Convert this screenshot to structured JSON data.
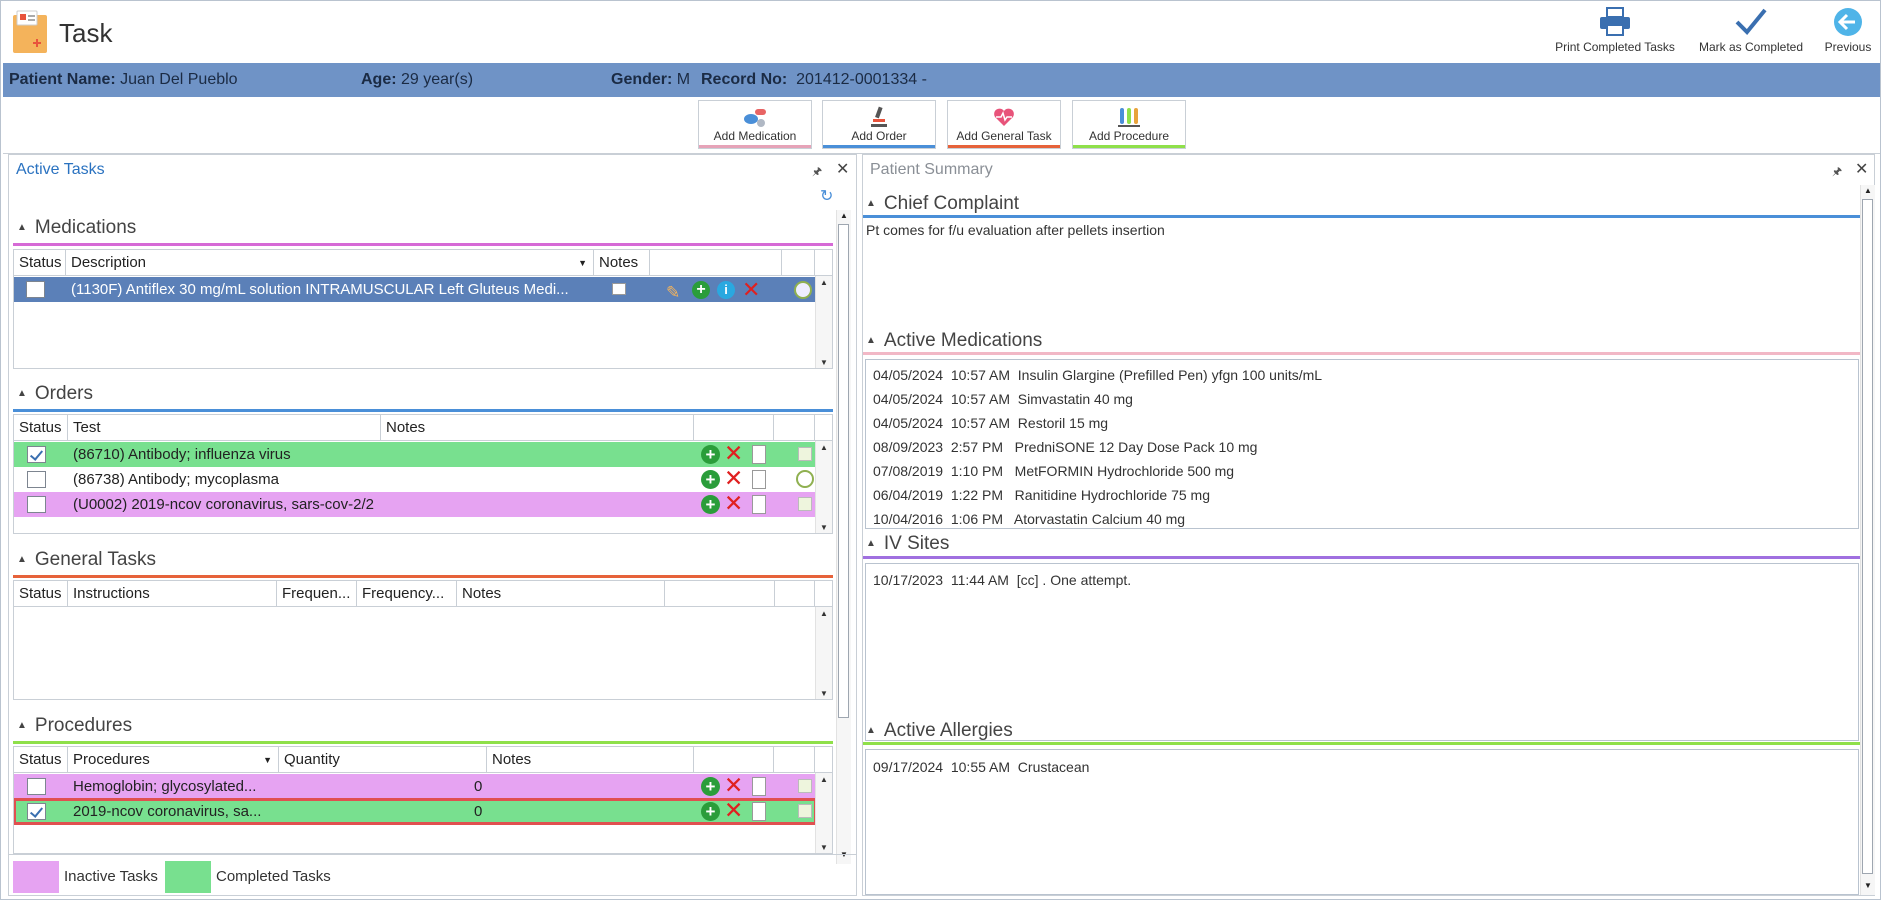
{
  "window": {
    "title": "Task"
  },
  "toolbar": {
    "print_label": "Print Completed Tasks",
    "complete_label": "Mark as Completed",
    "previous_label": "Previous"
  },
  "patient": {
    "name_label": "Patient Name:",
    "name": "Juan Del Pueblo",
    "age_label": "Age:",
    "age": "29 year(s)",
    "gender_label": "Gender:",
    "gender": "M",
    "record_label": "Record No:",
    "record": "201412-0001334 -"
  },
  "actions": {
    "add_medication": "Add Medication",
    "add_order": "Add Order",
    "add_general_task": "Add General Task",
    "add_procedure": "Add Procedure"
  },
  "active_tasks": {
    "title": "Active Tasks",
    "medications": {
      "heading": "Medications",
      "columns": [
        "Status",
        "Description",
        "Notes"
      ],
      "rows": [
        {
          "description": "(1130F) Antiflex 30 mg/mL solution INTRAMUSCULAR Left Gluteus Medi...",
          "checked": false
        }
      ]
    },
    "orders": {
      "heading": "Orders",
      "columns": [
        "Status",
        "Test",
        "Notes"
      ],
      "rows": [
        {
          "test": "(86710) Antibody; influenza virus",
          "checked": true,
          "state": "completed"
        },
        {
          "test": "(86738) Antibody; mycoplasma",
          "checked": false,
          "state": "active"
        },
        {
          "test": "(U0002) 2019-ncov coronavirus, sars-cov-2/2",
          "checked": false,
          "state": "inactive"
        }
      ]
    },
    "general_tasks": {
      "heading": "General Tasks",
      "columns": [
        "Status",
        "Instructions",
        "Frequen...",
        "Frequency...",
        "Notes"
      ]
    },
    "procedures": {
      "heading": "Procedures",
      "columns": [
        "Status",
        "Procedures",
        "Quantity",
        "Notes"
      ],
      "rows": [
        {
          "procedure": "Hemoglobin; glycosylated...",
          "quantity": "0",
          "checked": false,
          "state": "inactive"
        },
        {
          "procedure": "2019-ncov coronavirus, sa...",
          "quantity": "0",
          "checked": true,
          "state": "completed"
        }
      ]
    },
    "legend": {
      "inactive": "Inactive Tasks",
      "completed": "Completed Tasks"
    }
  },
  "patient_summary": {
    "title": "Patient Summary",
    "chief_complaint": {
      "heading": "Chief Complaint",
      "text": "Pt comes for f/u evaluation after pellets insertion"
    },
    "active_medications": {
      "heading": "Active Medications",
      "items": [
        {
          "date": "04/05/2024",
          "time": "10:57 AM",
          "name": "Insulin Glargine (Prefilled Pen)",
          "dose": "yfgn 100 units/mL"
        },
        {
          "date": "04/05/2024",
          "time": "10:57 AM",
          "name": "Simvastatin",
          "dose": "40 mg"
        },
        {
          "date": "04/05/2024",
          "time": "10:57 AM",
          "name": "Restoril",
          "dose": "15 mg"
        },
        {
          "date": "08/09/2023",
          "time": "2:57 PM",
          "name": "PredniSONE 12 Day Dose Pack",
          "dose": "10 mg"
        },
        {
          "date": "07/08/2019",
          "time": "1:10 PM",
          "name": "MetFORMIN Hydrochloride",
          "dose": "500 mg"
        },
        {
          "date": "06/04/2019",
          "time": "1:22 PM",
          "name": "Ranitidine Hydrochloride",
          "dose": "75 mg"
        },
        {
          "date": "10/04/2016",
          "time": "1:06 PM",
          "name": "Atorvastatin Calcium",
          "dose": "40 mg"
        }
      ]
    },
    "iv_sites": {
      "heading": "IV Sites",
      "items": [
        {
          "date": "10/17/2023",
          "time": "11:44 AM",
          "text": "[cc] . One attempt."
        }
      ]
    },
    "active_allergies": {
      "heading": "Active Allergies",
      "items": [
        {
          "date": "09/17/2024",
          "time": "10:55 AM",
          "text": "Crustacean"
        }
      ]
    }
  },
  "colors": {
    "patient_bar": "#6f93c6",
    "selected_row": "#5b80b8",
    "inactive": "#e6a3f2",
    "completed": "#78e08f",
    "medications_line": "#d66ad6",
    "orders_line": "#4a8fd8",
    "general_line": "#e6623a",
    "procedures_line": "#8fe04a"
  }
}
